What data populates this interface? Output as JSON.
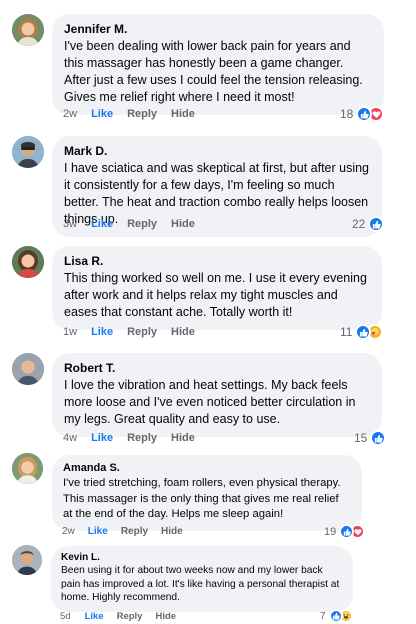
{
  "comments": [
    {
      "author": "Jennifer M.",
      "text": "I've been dealing with lower back pain for years and this massager has honestly been a game changer. After just a few uses I could feel the tension releasing. Gives me relief right where I need it most!",
      "time": "2w",
      "like_label": "Like",
      "reply_label": "Reply",
      "hide_label": "Hide",
      "reaction_count": "18",
      "reactions": [
        "like",
        "love"
      ],
      "avatar_icon": "woman-avatar-icon"
    },
    {
      "author": "Mark D.",
      "text": "I have sciatica and was skeptical at first, but after using it consistently for a few days, I'm feeling so much better. The heat and traction combo really helps loosen things up.",
      "time": "3w",
      "like_label": "Like",
      "reply_label": "Reply",
      "hide_label": "Hide",
      "reaction_count": "22",
      "reactions": [
        "like"
      ],
      "avatar_icon": "man-avatar-icon"
    },
    {
      "author": "Lisa R.",
      "text": "This thing worked so well on me. I use it every evening after work and it helps relax my tight muscles and eases that constant ache. Totally worth it!",
      "time": "1w",
      "like_label": "Like",
      "reply_label": "Reply",
      "hide_label": "Hide",
      "reaction_count": "11",
      "reactions": [
        "like",
        "care"
      ],
      "avatar_icon": "woman-avatar-icon"
    },
    {
      "author": "Robert T.",
      "text": "I love the vibration and heat settings. My back feels more loose and I've even noticed better circulation in my legs. Great quality and easy to use.",
      "time": "4w",
      "like_label": "Like",
      "reply_label": "Reply",
      "hide_label": "Hide",
      "reaction_count": "15",
      "reactions": [
        "like"
      ],
      "avatar_icon": "man-avatar-icon"
    },
    {
      "author": "Amanda S.",
      "text": "I've tried stretching, foam rollers, even physical therapy. This massager is the only thing that gives me real relief at the end of the day. Helps me sleep again!",
      "time": "2w",
      "like_label": "Like",
      "reply_label": "Reply",
      "hide_label": "Hide",
      "reaction_count": "19",
      "reactions": [
        "like",
        "love"
      ],
      "avatar_icon": "woman-avatar-icon"
    },
    {
      "author": "Kevin L.",
      "text": "Been using it for about two weeks now and my lower back pain has improved a lot. It's like having a personal therapist at home. Highly recommend.",
      "time": "5d",
      "like_label": "Like",
      "reply_label": "Reply",
      "hide_label": "Hide",
      "reaction_count": "7",
      "reactions": [
        "like",
        "haha"
      ],
      "avatar_icon": "man-avatar-icon"
    }
  ],
  "colors": {
    "bubble": "#f0f2f5",
    "like_blue": "#1877f2",
    "meta_gray": "#65676b",
    "love_red": "#f33e58",
    "care_yellow": "#f7b125"
  }
}
